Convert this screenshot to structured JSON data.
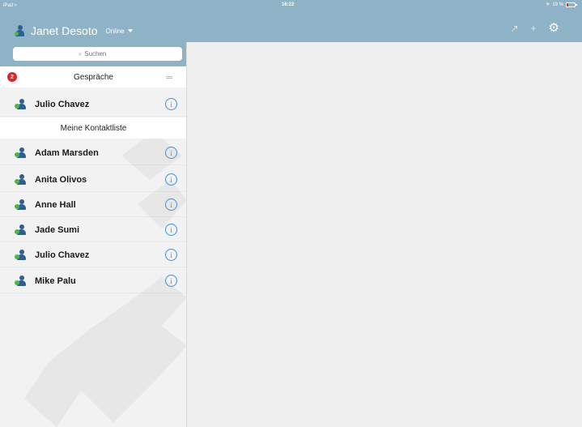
{
  "statusbar": {
    "device": "iPad",
    "wifi": "▿",
    "time": "16:22",
    "bluetooth": "✳",
    "battery": "19 %"
  },
  "header": {
    "user_name": "Janet Desoto",
    "presence": "Online",
    "icons": [
      "expand-icon",
      "plus-icon",
      "gear-icon"
    ],
    "expand_glyph": "↗",
    "add_glyph": "+",
    "settings_glyph": "⚙"
  },
  "search": {
    "placeholder": "Suchen",
    "glyph": "⌕"
  },
  "conversations": {
    "title": "Gespräche",
    "unread_count": "2",
    "items": [
      {
        "name": "Julio Chavez"
      }
    ]
  },
  "contacts": {
    "title": "Meine Kontaktliste",
    "items": [
      {
        "name": "Adam Marsden"
      },
      {
        "name": "Anita Olivos"
      },
      {
        "name": "Anne Hall"
      },
      {
        "name": "Jade Sumi"
      },
      {
        "name": "Julio Chavez"
      },
      {
        "name": "Mike Palu"
      }
    ]
  },
  "info_glyph": "i",
  "colors": {
    "header_bg": "#8fb3c6",
    "accent_blue": "#3f8fd6",
    "presence_green": "#4fb548",
    "badge_red": "#d9262c"
  }
}
